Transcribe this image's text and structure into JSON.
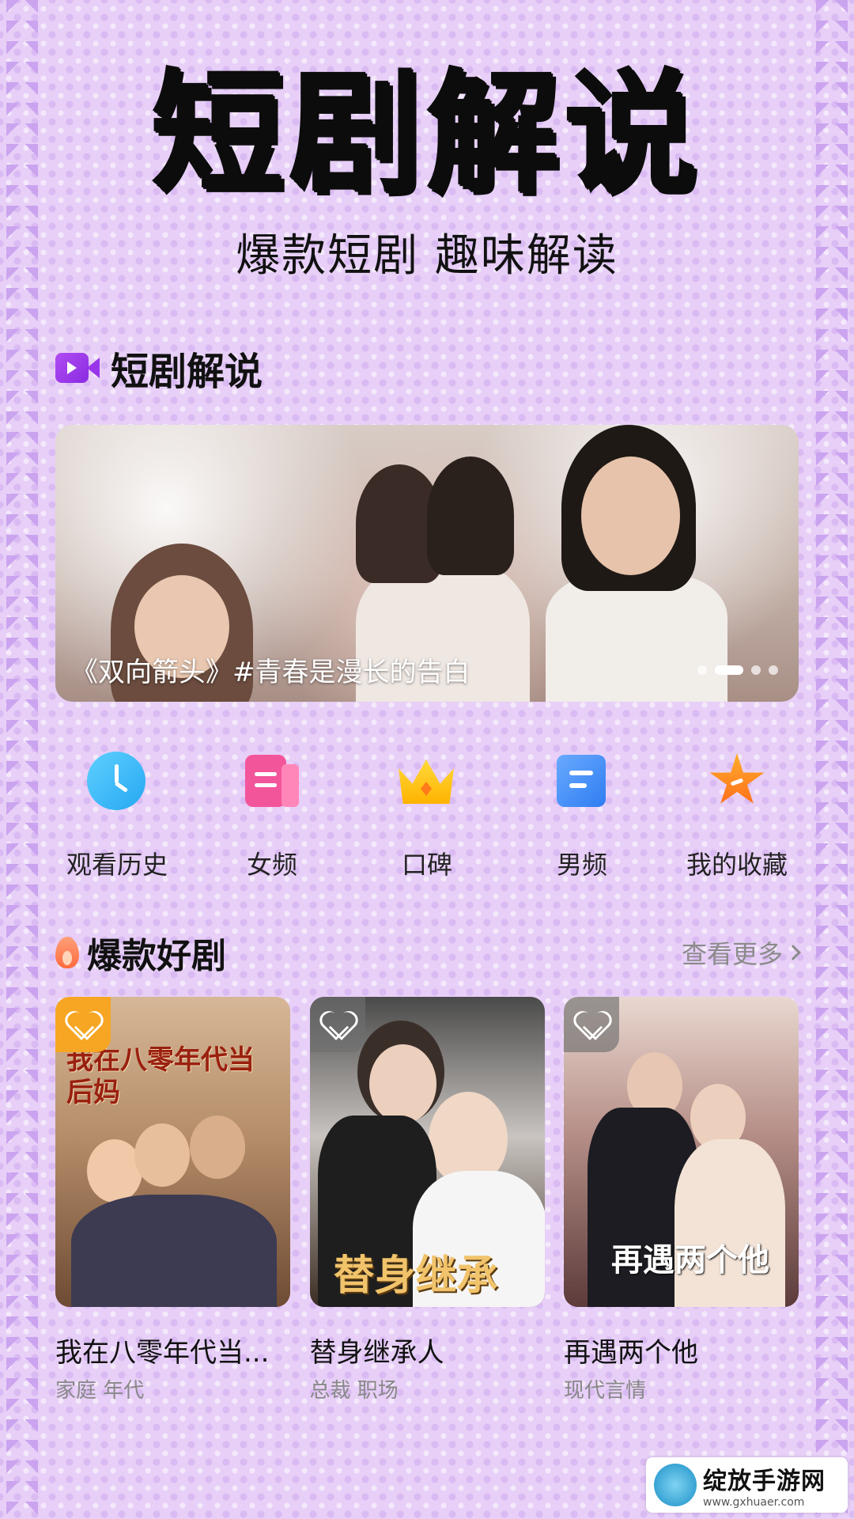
{
  "hero": {
    "title": "短剧解说",
    "subtitle": "爆款短剧 趣味解读"
  },
  "section_header": {
    "icon": "video-camera-icon",
    "title": "短剧解说"
  },
  "banner": {
    "caption": "《双向箭头》#青春是漫长的告白",
    "total_slides": 4,
    "active_slide": 2
  },
  "quick_nav": [
    {
      "label": "观看历史",
      "icon": "clock-icon",
      "color": "#25a8f2"
    },
    {
      "label": "女频",
      "icon": "book-icon",
      "color": "#f3559b"
    },
    {
      "label": "口碑",
      "icon": "crown-icon",
      "color": "#ffc21a"
    },
    {
      "label": "男频",
      "icon": "document-icon",
      "color": "#2f7df2"
    },
    {
      "label": "我的收藏",
      "icon": "star-icon",
      "color": "#ff7a1a"
    }
  ],
  "hot_section": {
    "title": "爆款好剧",
    "more_label": "查看更多"
  },
  "dramas": [
    {
      "title": "我在八零年代当...",
      "tags": "家庭 年代",
      "poster_text": "我在八零年代当后妈",
      "favorited": true
    },
    {
      "title": "替身继承人",
      "tags": "总裁 职场",
      "poster_text": "替身继承",
      "favorited": false
    },
    {
      "title": "再遇两个他",
      "tags": "现代言情",
      "poster_text": "再遇两个他",
      "favorited": false
    }
  ],
  "watermark": {
    "name": "绽放手游网",
    "url": "www.gxhuaer.com"
  }
}
